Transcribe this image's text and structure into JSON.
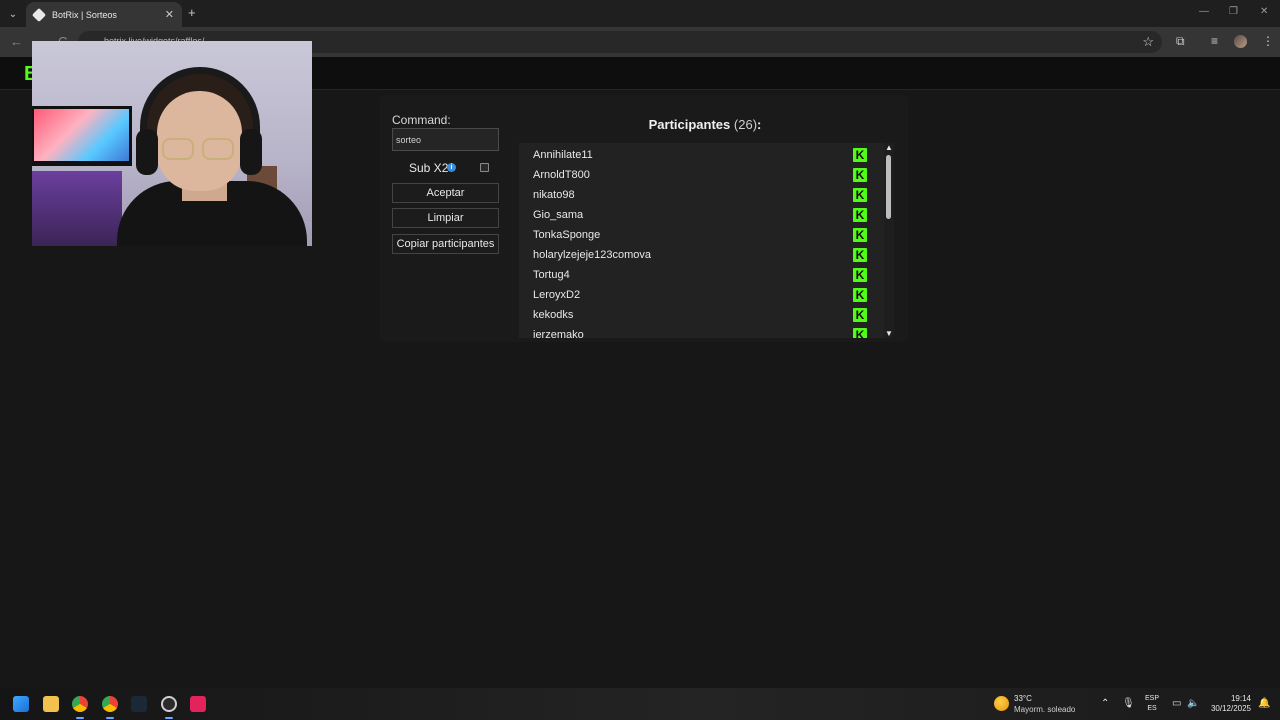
{
  "browser": {
    "tab_title": "BotRix | Sorteos",
    "tab_close": "✕",
    "new_tab": "+",
    "url": "botrix.live/widgets/raffles/",
    "back": "←",
    "forward": "→",
    "reload": "C"
  },
  "site": {
    "brand_letter": "B"
  },
  "form": {
    "command_label": "Command:",
    "command_value": "sorteo",
    "sub_label": "Sub X2",
    "info_glyph": "i",
    "accept_label": "Aceptar",
    "clear_label": "Limpiar",
    "copy_label": "Copiar participantes"
  },
  "participants": {
    "title": "Participantes",
    "count": "(26)",
    "colon": ":",
    "badge_letter": "K",
    "names": [
      "Annihilate11",
      "ArnoldT800",
      "nikato98",
      "Gio_sama",
      "TonkaSponge",
      "holarylzejeje123comova",
      "Tortug4",
      "LeroyxD2",
      "kekodks",
      "jerzemako"
    ],
    "badge_color": "#53fc18"
  },
  "taskbar": {
    "temp": "33°C",
    "weather_desc": "Mayorm. soleado",
    "lang_1": "ESP",
    "lang_2": "ES",
    "time": "19:14",
    "date": "30/12/2025"
  }
}
